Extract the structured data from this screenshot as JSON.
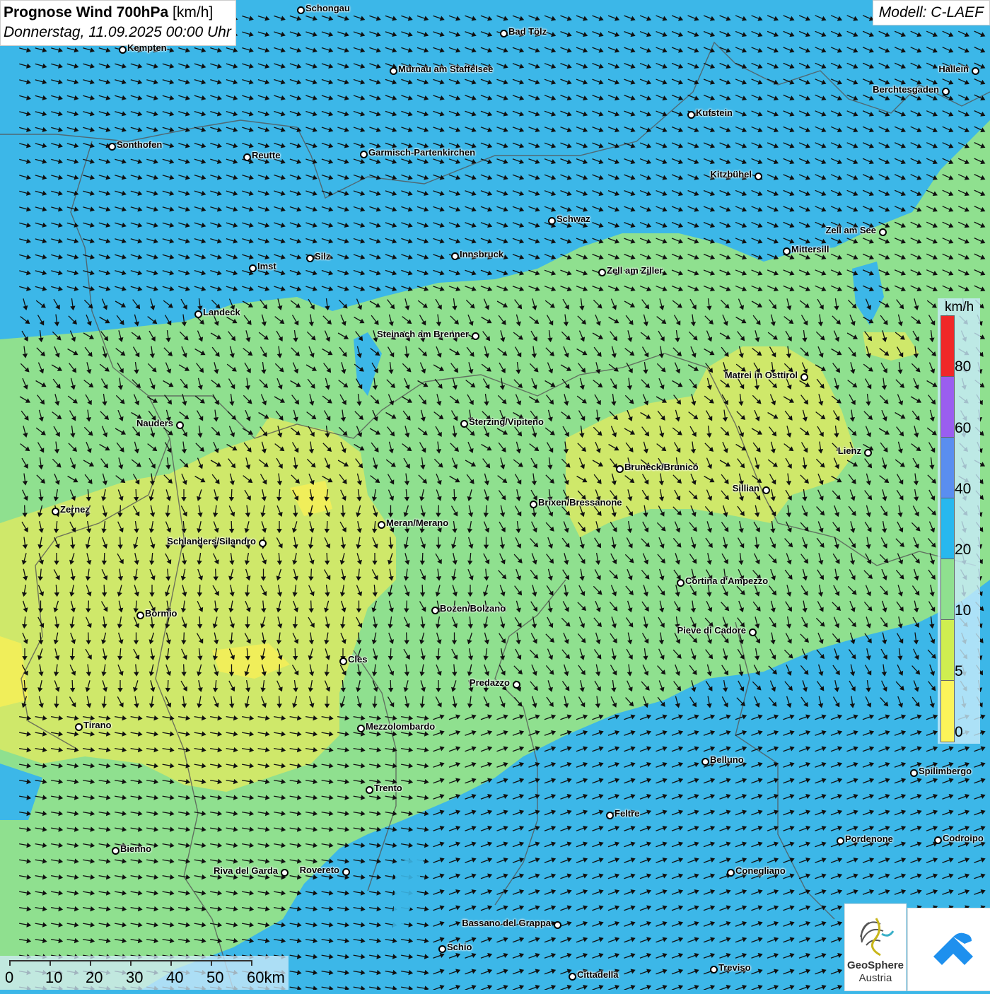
{
  "title": {
    "main": "Prognose Wind 700hPa",
    "unit": "[km/h]",
    "date": "Donnerstag, 11.09.2025 00:00 Uhr"
  },
  "model": "Modell: C-LAEF",
  "colors": {
    "sea_blue": "#3cb7e8",
    "green_10_20": "#8fe08f",
    "yellow_green_5_10": "#cfe86a",
    "yellow_0_5": "#f0ee5a"
  },
  "legend": {
    "unit": "km/h",
    "ticks": [
      "80",
      "60",
      "40",
      "20",
      "10",
      "5",
      "0"
    ],
    "bands": [
      {
        "color": "#f02828",
        "from": 80
      },
      {
        "color": "#9a5ef0",
        "from": 60
      },
      {
        "color": "#5a8ef0",
        "from": 40
      },
      {
        "color": "#28b8ee",
        "from": 20
      },
      {
        "color": "#8fe08f",
        "from": 10
      },
      {
        "color": "#cfee50",
        "from": 5
      },
      {
        "color": "#fbf45a",
        "from": 0
      }
    ]
  },
  "scale": {
    "labels": [
      "0",
      "10",
      "20",
      "30",
      "40",
      "50",
      "60km"
    ]
  },
  "logo": {
    "name": "GeoSphere",
    "sub": "Austria",
    "icon": "geosphere-logo-icon",
    "app_icon": "weather-app-icon"
  },
  "cities": [
    {
      "name": "Schongau"
    },
    {
      "name": "Bad Tölz"
    },
    {
      "name": "Kempten"
    },
    {
      "name": "Murnau am Staffelsee"
    },
    {
      "name": "Hallein"
    },
    {
      "name": "Berchtesgaden"
    },
    {
      "name": "Kufstein"
    },
    {
      "name": "Sonthofen"
    },
    {
      "name": "Reutte"
    },
    {
      "name": "Garmisch-Partenkirchen"
    },
    {
      "name": "Kitzbühel"
    },
    {
      "name": "Schwaz"
    },
    {
      "name": "Zell am See"
    },
    {
      "name": "Mittersill"
    },
    {
      "name": "Innsbruck"
    },
    {
      "name": "Silz"
    },
    {
      "name": "Imst"
    },
    {
      "name": "Zell am Ziller"
    },
    {
      "name": "Landeck"
    },
    {
      "name": "Steinach am Brenner"
    },
    {
      "name": "Matrei in Osttirol"
    },
    {
      "name": "Nauders"
    },
    {
      "name": "Sterzing/Vipiteno"
    },
    {
      "name": "Lienz"
    },
    {
      "name": "Bruneck/Brunico"
    },
    {
      "name": "Sillian"
    },
    {
      "name": "Zernez"
    },
    {
      "name": "Brixen/Bressanone"
    },
    {
      "name": "Meran/Merano"
    },
    {
      "name": "Schlanders/Silandro"
    },
    {
      "name": "Cortina d'Ampezzo"
    },
    {
      "name": "Bozen/Bolzano"
    },
    {
      "name": "Bormio"
    },
    {
      "name": "Pieve di Cadore"
    },
    {
      "name": "Cles"
    },
    {
      "name": "Predazzo"
    },
    {
      "name": "Tirano"
    },
    {
      "name": "Mezzolombardo"
    },
    {
      "name": "Belluno"
    },
    {
      "name": "Spilimbergo"
    },
    {
      "name": "Trento"
    },
    {
      "name": "Feltre"
    },
    {
      "name": "Pordenone"
    },
    {
      "name": "Codroipo"
    },
    {
      "name": "Bienno"
    },
    {
      "name": "Riva del Garda"
    },
    {
      "name": "Rovereto"
    },
    {
      "name": "Conegliano"
    },
    {
      "name": "Bassano del Grappa"
    },
    {
      "name": "Schio"
    },
    {
      "name": "Treviso"
    },
    {
      "name": "Cittadella"
    }
  ]
}
